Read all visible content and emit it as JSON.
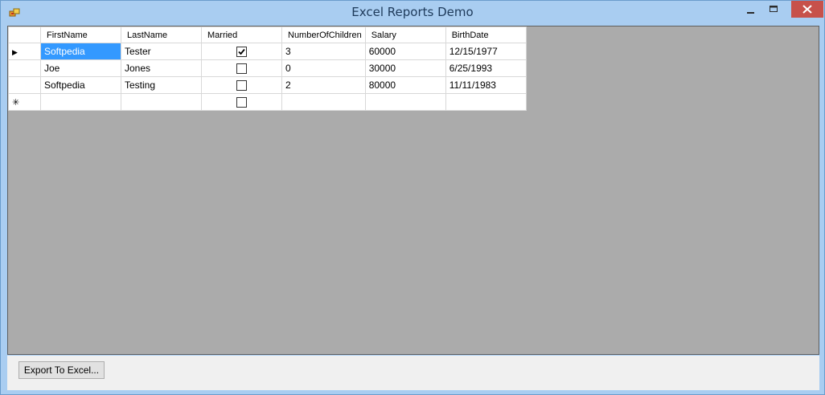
{
  "window": {
    "title": "Excel Reports Demo",
    "colors": {
      "titlebar": "#a9cdf1",
      "close_button": "#c7514a",
      "grid_background": "#ababab",
      "selection": "#3399ff"
    }
  },
  "grid": {
    "columns": [
      "FirstName",
      "LastName",
      "Married",
      "NumberOfChildren",
      "Salary",
      "BirthDate"
    ],
    "rows": [
      {
        "FirstName": "Softpedia",
        "LastName": "Tester",
        "Married": true,
        "NumberOfChildren": "3",
        "Salary": "60000",
        "BirthDate": "12/15/1977"
      },
      {
        "FirstName": "Joe",
        "LastName": "Jones",
        "Married": false,
        "NumberOfChildren": "0",
        "Salary": "30000",
        "BirthDate": "6/25/1993"
      },
      {
        "FirstName": "Softpedia",
        "LastName": "Testing",
        "Married": false,
        "NumberOfChildren": "2",
        "Salary": "80000",
        "BirthDate": "11/11/1983"
      }
    ],
    "new_row_marker": "✳",
    "current_row_marker": "▶"
  },
  "footer": {
    "export_label": "Export To Excel..."
  }
}
